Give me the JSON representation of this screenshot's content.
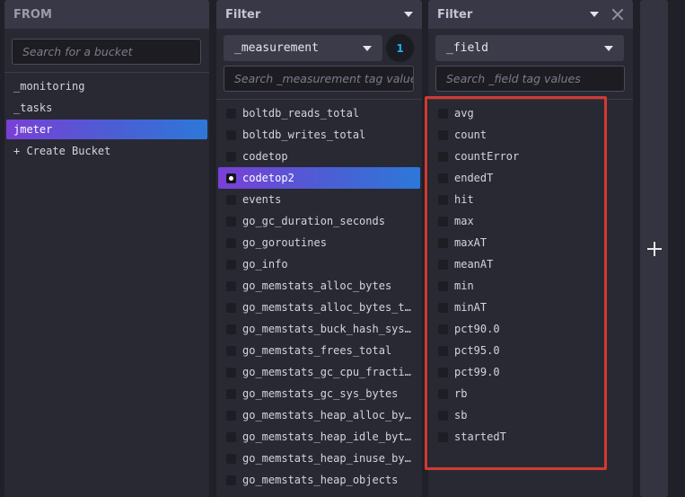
{
  "from_panel": {
    "title": "FROM",
    "search_placeholder": "Search for a bucket",
    "buckets": [
      {
        "label": "_monitoring",
        "selected": false
      },
      {
        "label": "_tasks",
        "selected": false
      },
      {
        "label": "jmeter",
        "selected": true
      }
    ],
    "create_label": "+ Create Bucket"
  },
  "filter1": {
    "title": "Filter",
    "key_label": "_measurement",
    "badge_count": "1",
    "search_placeholder": "Search _measurement tag values",
    "values": [
      {
        "label": "boltdb_reads_total",
        "checked": false
      },
      {
        "label": "boltdb_writes_total",
        "checked": false
      },
      {
        "label": "codetop",
        "checked": false
      },
      {
        "label": "codetop2",
        "checked": true
      },
      {
        "label": "events",
        "checked": false
      },
      {
        "label": "go_gc_duration_seconds",
        "checked": false
      },
      {
        "label": "go_goroutines",
        "checked": false
      },
      {
        "label": "go_info",
        "checked": false
      },
      {
        "label": "go_memstats_alloc_bytes",
        "checked": false
      },
      {
        "label": "go_memstats_alloc_bytes_t…",
        "checked": false
      },
      {
        "label": "go_memstats_buck_hash_sys…",
        "checked": false
      },
      {
        "label": "go_memstats_frees_total",
        "checked": false
      },
      {
        "label": "go_memstats_gc_cpu_fracti…",
        "checked": false
      },
      {
        "label": "go_memstats_gc_sys_bytes",
        "checked": false
      },
      {
        "label": "go_memstats_heap_alloc_by…",
        "checked": false
      },
      {
        "label": "go_memstats_heap_idle_byt…",
        "checked": false
      },
      {
        "label": "go_memstats_heap_inuse_by…",
        "checked": false
      },
      {
        "label": "go_memstats_heap_objects",
        "checked": false
      }
    ]
  },
  "filter2": {
    "title": "Filter",
    "key_label": "_field",
    "search_placeholder": "Search _field tag values",
    "values": [
      {
        "label": "avg",
        "checked": false
      },
      {
        "label": "count",
        "checked": false
      },
      {
        "label": "countError",
        "checked": false
      },
      {
        "label": "endedT",
        "checked": false
      },
      {
        "label": "hit",
        "checked": false
      },
      {
        "label": "max",
        "checked": false
      },
      {
        "label": "maxAT",
        "checked": false
      },
      {
        "label": "meanAT",
        "checked": false
      },
      {
        "label": "min",
        "checked": false
      },
      {
        "label": "minAT",
        "checked": false
      },
      {
        "label": "pct90.0",
        "checked": false
      },
      {
        "label": "pct95.0",
        "checked": false
      },
      {
        "label": "pct99.0",
        "checked": false
      },
      {
        "label": "rb",
        "checked": false
      },
      {
        "label": "sb",
        "checked": false
      },
      {
        "label": "startedT",
        "checked": false
      }
    ]
  },
  "icons": {
    "dropdown": "caret-down-icon",
    "close": "close-icon",
    "add": "plus-icon"
  },
  "colors": {
    "selection_gradient": [
      "#7a3fd6",
      "#2d78d8"
    ],
    "badge_text": "#22adf6",
    "annotation_border": "#d23a32"
  }
}
